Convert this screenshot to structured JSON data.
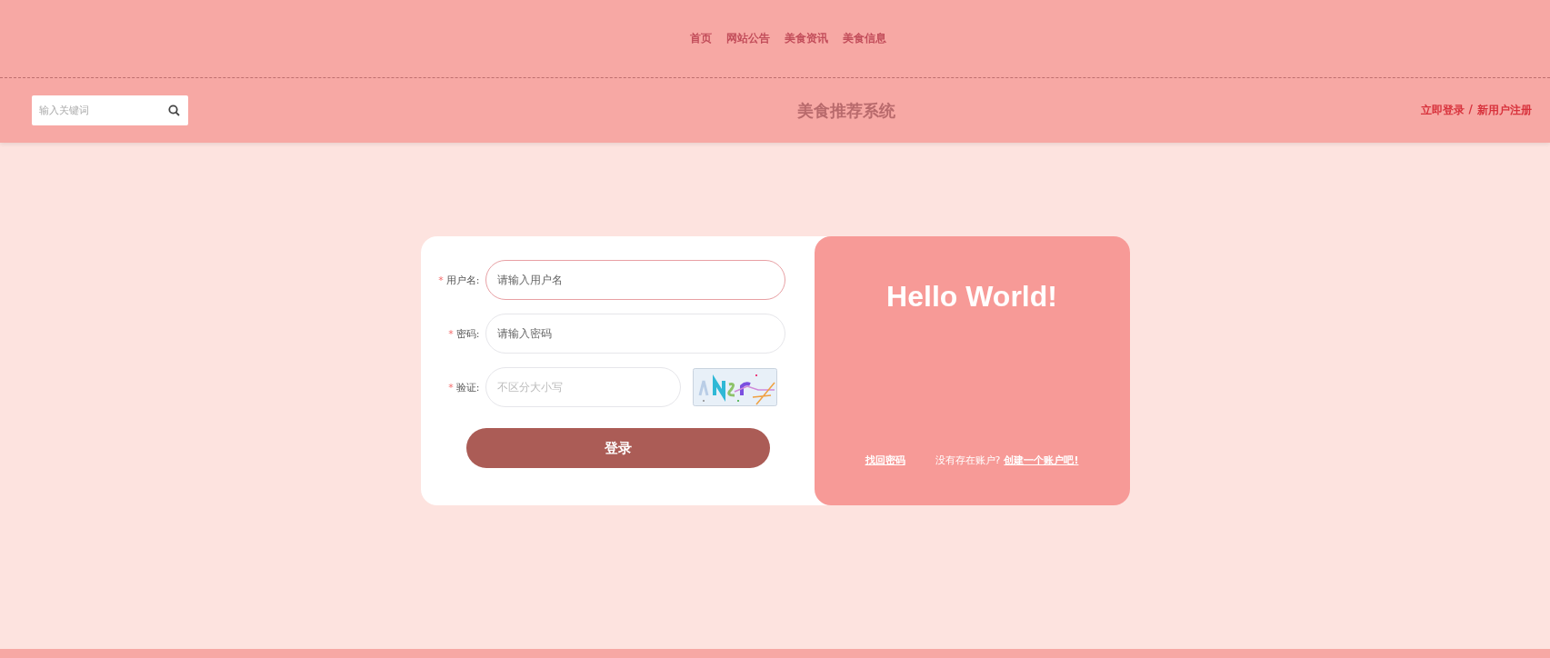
{
  "nav": [
    {
      "label": "首页"
    },
    {
      "label": "网站公告"
    },
    {
      "label": "美食资讯"
    },
    {
      "label": "美食信息"
    }
  ],
  "header": {
    "search": {
      "placeholder": "输入关键词"
    },
    "title": "美食推荐系统",
    "login_link": "立即登录",
    "separator": "/",
    "register_link": "新用户注册"
  },
  "login_form": {
    "fields": [
      {
        "label": "用户名:",
        "marker": "*",
        "placeholder": "请输入用户名",
        "focused": true,
        "kind": "text"
      },
      {
        "label": "密码:",
        "marker": "*",
        "placeholder": "请输入密码",
        "focused": false,
        "kind": "text"
      },
      {
        "label": "验证:",
        "marker": "*",
        "placeholder": "不区分大小写",
        "focused": false,
        "kind": "captcha"
      }
    ],
    "submit": "登录"
  },
  "welcome_panel": {
    "heading": "Hello World!",
    "forgot_link": "找回密码",
    "no_account_text": "没有存在账户?",
    "create_link": "创建一个账户吧!"
  }
}
